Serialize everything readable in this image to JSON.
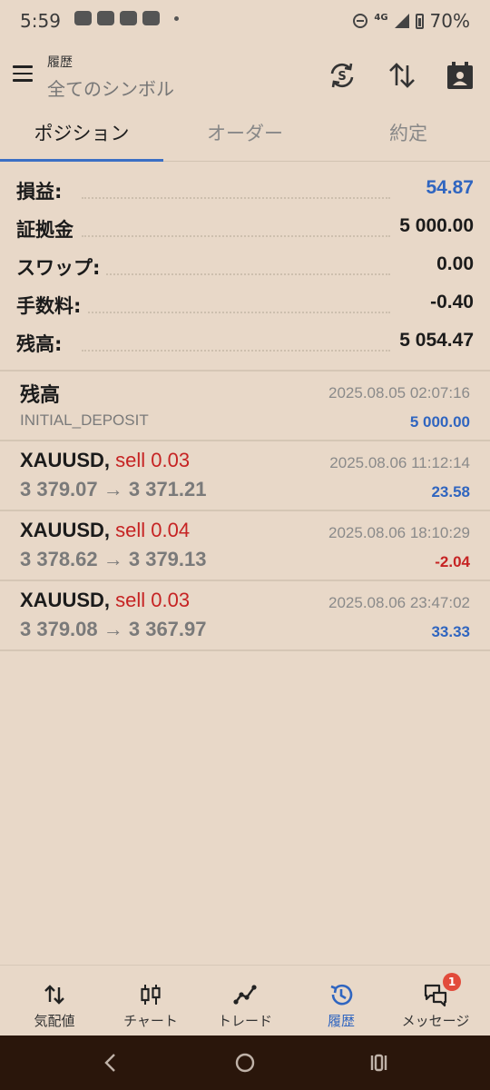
{
  "status_bar": {
    "time": "5:59",
    "network": "4G",
    "battery": "70%"
  },
  "app_bar": {
    "subtitle": "履歴",
    "title": "全てのシンボル"
  },
  "tabs": [
    {
      "label": "ポジション",
      "active": true
    },
    {
      "label": "オーダー",
      "active": false
    },
    {
      "label": "約定",
      "active": false
    }
  ],
  "summary": [
    {
      "label": "損益:",
      "value": "54.87",
      "color": "#2f65c0"
    },
    {
      "label": "証拠金",
      "value": "5 000.00",
      "color": "#1b1b1b"
    },
    {
      "label": "スワップ:",
      "value": "0.00",
      "color": "#1b1b1b"
    },
    {
      "label": "手数料:",
      "value": "-0.40",
      "color": "#1b1b1b"
    },
    {
      "label": "残高:",
      "value": "5 054.47",
      "color": "#1b1b1b"
    }
  ],
  "deposit": {
    "title": "残高",
    "type": "INITIAL_DEPOSIT",
    "time": "2025.08.05 02:07:16",
    "amount": "5 000.00"
  },
  "deals": [
    {
      "symbol": "XAUUSD,",
      "side": "sell 0.03",
      "prices": "3 379.07 → 3 371.21",
      "time": "2025.08.06 11:12:14",
      "profit": "23.58",
      "profit_color": "#2f65c0"
    },
    {
      "symbol": "XAUUSD,",
      "side": "sell 0.04",
      "prices": "3 378.62 → 3 379.13",
      "time": "2025.08.06 18:10:29",
      "profit": "-2.04",
      "profit_color": "#c62323"
    },
    {
      "symbol": "XAUUSD,",
      "side": "sell 0.03",
      "prices": "3 379.08 → 3 367.97",
      "time": "2025.08.06 23:47:02",
      "profit": "33.33",
      "profit_color": "#2f65c0"
    }
  ],
  "bottom_nav": [
    {
      "label": "気配値",
      "icon": "quotes-arrows-icon",
      "active": false
    },
    {
      "label": "チャート",
      "icon": "candlestick-icon",
      "active": false
    },
    {
      "label": "トレード",
      "icon": "trade-line-icon",
      "active": false
    },
    {
      "label": "履歴",
      "icon": "history-clock-icon",
      "active": true
    },
    {
      "label": "メッセージ",
      "icon": "chat-bubbles-icon",
      "active": false,
      "badge": "1"
    }
  ],
  "colors": {
    "background": "#e8d8c8",
    "accent_blue": "#2f65c0",
    "loss_red": "#c62323"
  }
}
